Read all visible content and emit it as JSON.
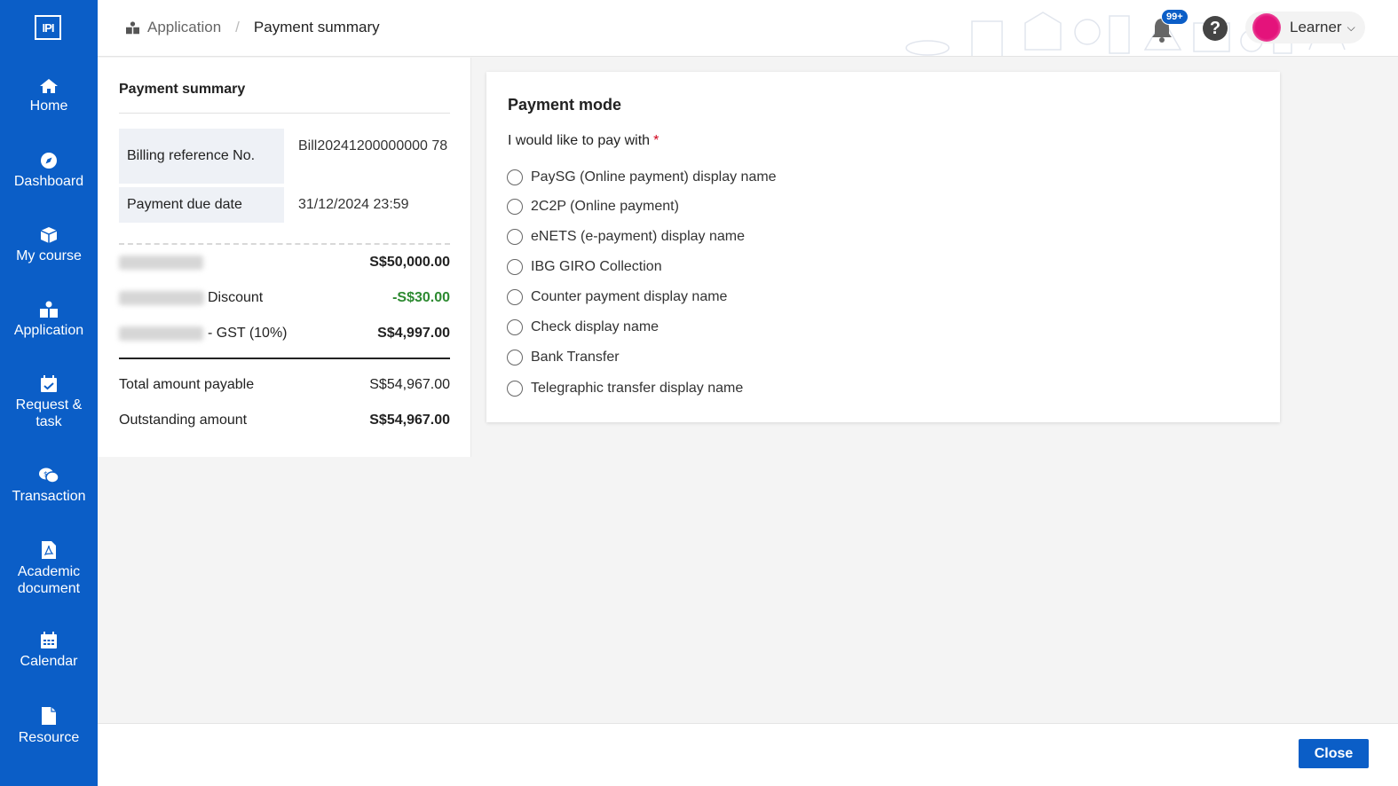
{
  "sidebar": {
    "logo_text": "IPI",
    "items": [
      {
        "label": "Home",
        "icon": "home-icon"
      },
      {
        "label": "Dashboard",
        "icon": "compass-icon"
      },
      {
        "label": "My course",
        "icon": "box-icon"
      },
      {
        "label": "Application",
        "icon": "application-icon"
      },
      {
        "label": "Request & task",
        "icon": "calendar-check-icon"
      },
      {
        "label": "Transaction",
        "icon": "transaction-icon"
      },
      {
        "label": "Academic document",
        "icon": "pdf-document-icon"
      },
      {
        "label": "Calendar",
        "icon": "calendar-icon"
      },
      {
        "label": "Resource",
        "icon": "file-icon"
      }
    ]
  },
  "header": {
    "breadcrumb": {
      "parent": "Application",
      "current": "Payment summary"
    },
    "notification_badge": "99+",
    "help_symbol": "?",
    "user_name": "Learner"
  },
  "summary": {
    "title": "Payment summary",
    "billing_ref_label": "Billing reference No.",
    "billing_ref_value": "Bill20241200000000 78",
    "due_date_label": "Payment due date",
    "due_date_value": "31/12/2024 23:59",
    "lines": [
      {
        "suffix": "",
        "amount": "S$50,000.00"
      },
      {
        "suffix": "Discount",
        "amount": "-S$30.00"
      },
      {
        "suffix": "- GST (10%)",
        "amount": "S$4,997.00"
      }
    ],
    "total_label": "Total amount payable",
    "total_value": "S$54,967.00",
    "outstanding_label": "Outstanding amount",
    "outstanding_value": "S$54,967.00"
  },
  "payment_mode": {
    "title": "Payment mode",
    "prompt": "I would like to pay with",
    "required_mark": "*",
    "options": [
      "PaySG (Online payment) display name",
      "2C2P (Online payment)",
      "eNETS (e-payment) display name",
      "IBG GIRO Collection",
      "Counter payment display name",
      "Check display name",
      "Bank Transfer",
      "Telegraphic transfer display name"
    ]
  },
  "footer": {
    "close_label": "Close"
  },
  "colors": {
    "primary": "#0b5ec7",
    "discount": "#2d8a31",
    "required": "#d0021b"
  }
}
